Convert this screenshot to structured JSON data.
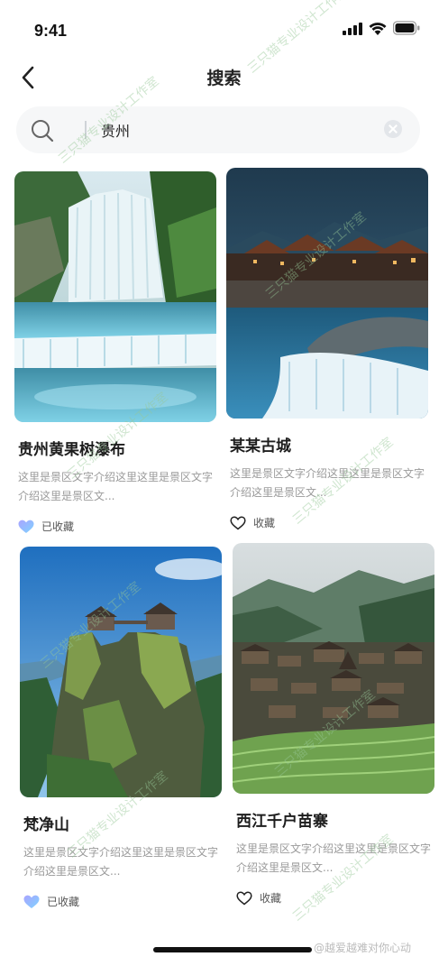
{
  "status_bar": {
    "time": "9:41",
    "icons": [
      "signal-icon",
      "wifi-icon",
      "battery-icon"
    ]
  },
  "nav": {
    "back_icon": "chevron-left-icon",
    "title": "搜索"
  },
  "search": {
    "icon": "search-icon",
    "value": "贵州",
    "clear_icon": "clear-icon"
  },
  "cards": [
    {
      "title": "贵州黄果树瀑布",
      "desc": "这里是景区文字介绍这里这里是景区文字介绍这里是景区文...",
      "fav_label": "已收藏",
      "favorited": true,
      "fav_icon": "heart-filled-icon"
    },
    {
      "title": "某某古城",
      "desc": "这里是景区文字介绍这里这里是景区文字介绍这里是景区文...",
      "fav_label": "收藏",
      "favorited": false,
      "fav_icon": "heart-outline-icon"
    },
    {
      "title": "梵净山",
      "desc": "这里是景区文字介绍这里这里是景区文字介绍这里是景区文...",
      "fav_label": "已收藏",
      "favorited": true,
      "fav_icon": "heart-filled-icon"
    },
    {
      "title": "西江千户苗寨",
      "desc": "这里是景区文字介绍这里这里是景区文字介绍这里是景区文...",
      "fav_label": "收藏",
      "favorited": false,
      "fav_icon": "heart-outline-icon"
    }
  ],
  "watermark": "三只猫专业设计工作室",
  "source_tag": "@越爱越难对你心动",
  "colors": {
    "accent_gradient_start": "#a9a4ff",
    "accent_gradient_end": "#7fd3ff",
    "text_primary": "#1d1d1d",
    "text_secondary": "#9a9a9a",
    "search_bg": "#f6f7f8"
  }
}
